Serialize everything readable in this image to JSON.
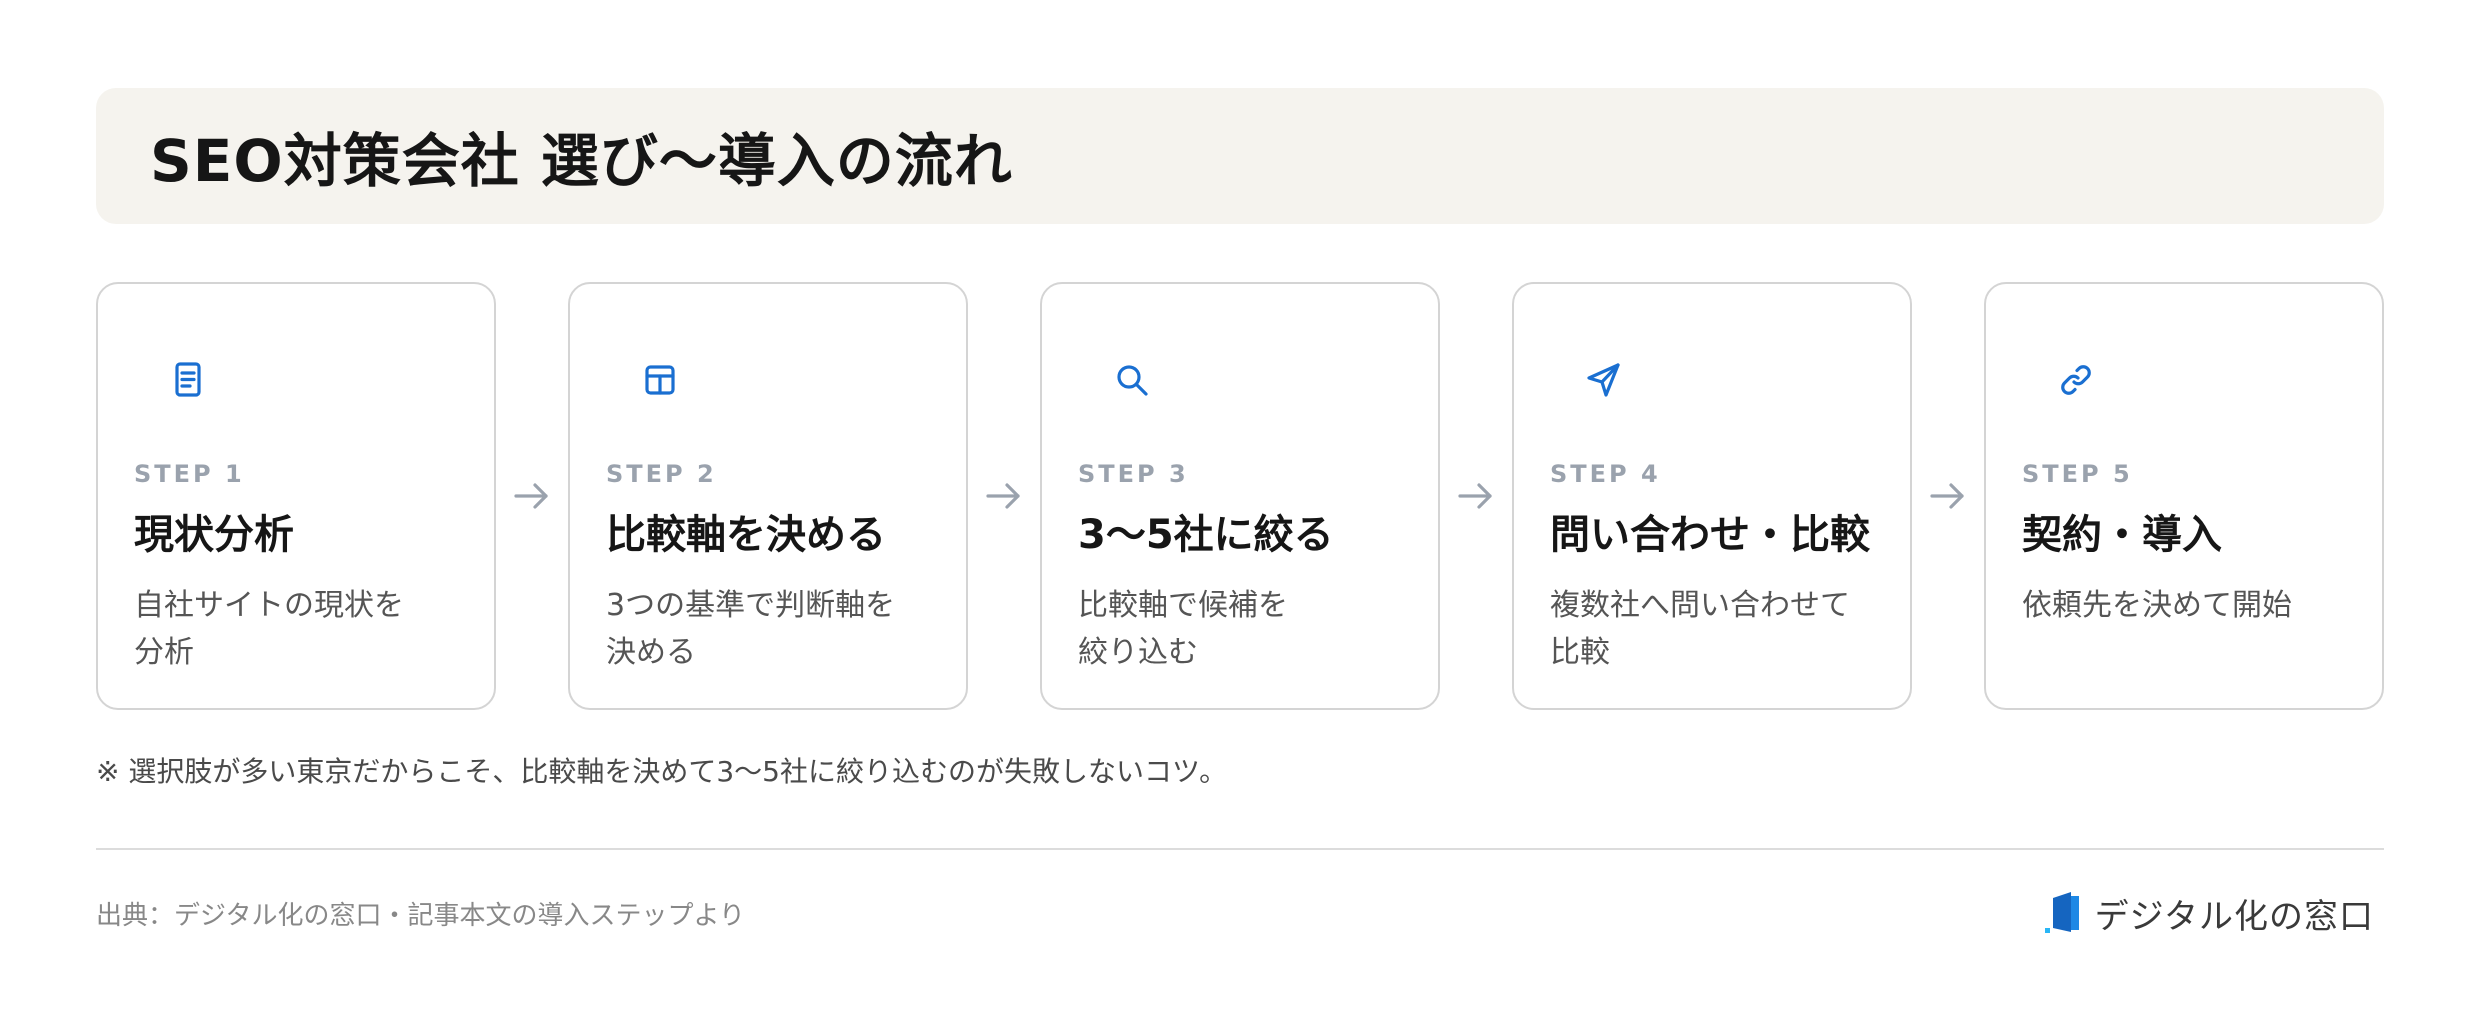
{
  "title": "SEO対策会社 選び〜導入の流れ",
  "steps": [
    {
      "label": "STEP 1",
      "title": "現状分析",
      "desc": "自社サイトの現状を\n分析",
      "icon": "document-icon"
    },
    {
      "label": "STEP 2",
      "title": "比較軸を決める",
      "desc": "3つの基準で判断軸を\n決める",
      "icon": "table-icon"
    },
    {
      "label": "STEP 3",
      "title": "3〜5社に絞る",
      "desc": "比較軸で候補を\n絞り込む",
      "icon": "search-icon"
    },
    {
      "label": "STEP 4",
      "title": "問い合わせ・比較",
      "desc": "複数社へ問い合わせて\n比較",
      "icon": "send-icon"
    },
    {
      "label": "STEP 5",
      "title": "契約・導入",
      "desc": "依頼先を決めて開始",
      "icon": "link-icon"
    }
  ],
  "note": "※ 選択肢が多い東京だからこそ、比較軸を決めて3〜5社に絞り込むのが失敗しないコツ。",
  "footer": {
    "source": "出典：デジタル化の窓口・記事本文の導入ステップより",
    "brand": "デジタル化の窓口"
  },
  "colors": {
    "accent": "#1a6fd1",
    "banner_bg": "#f5f3ee",
    "card_border": "#d4d4d4",
    "step_label": "#9aa2ad",
    "arrow": "#9aa2ad"
  }
}
